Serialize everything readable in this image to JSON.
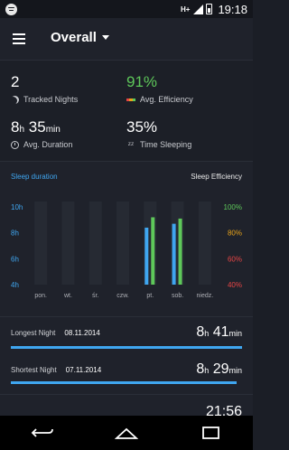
{
  "status_bar": {
    "network": "H+",
    "time": "19:18"
  },
  "app": {
    "title": "Overall",
    "accent": "#3fa6f0",
    "efficiency_green": "#5ec85a"
  },
  "summary": {
    "tracked_nights": {
      "value": "2",
      "label": "Tracked Nights"
    },
    "avg_efficiency": {
      "value": "91%",
      "label": "Avg. Efficiency"
    },
    "avg_duration": {
      "hours": "8",
      "h_unit": "h",
      "minutes": "35",
      "m_unit": "min",
      "label": "Avg. Duration"
    },
    "time_sleeping": {
      "value": "35%",
      "label": "Time Sleeping"
    }
  },
  "chart": {
    "left_title": "Sleep duration",
    "right_title": "Sleep Efficiency",
    "left_ticks": [
      "10h",
      "8h",
      "6h",
      "4h"
    ],
    "right_ticks": [
      "100%",
      "80%",
      "60%",
      "40%"
    ],
    "right_tick_colors": [
      "#5ec85a",
      "#e6a21a",
      "#e64545",
      "#e64545"
    ],
    "days": [
      "pon.",
      "wt.",
      "śr.",
      "czw.",
      "pt.",
      "sob.",
      "niedz."
    ]
  },
  "chart_data": {
    "type": "bar",
    "categories": [
      "pon.",
      "wt.",
      "śr.",
      "czw.",
      "pt.",
      "sob.",
      "niedz."
    ],
    "series": [
      {
        "name": "Sleep duration",
        "color": "#3fa6f0",
        "unit": "h",
        "values": [
          null,
          null,
          null,
          null,
          8.4,
          8.7,
          null
        ]
      },
      {
        "name": "Sleep Efficiency",
        "color": "#5ec85a",
        "unit": "%",
        "values": [
          null,
          null,
          null,
          null,
          92,
          91,
          null
        ]
      }
    ],
    "title": "",
    "left_axis": {
      "label": "Sleep duration",
      "ticks": [
        10,
        8,
        6,
        4
      ],
      "range": [
        4,
        10
      ]
    },
    "right_axis": {
      "label": "Sleep Efficiency",
      "ticks": [
        100,
        80,
        60,
        40
      ],
      "range": [
        40,
        100
      ]
    }
  },
  "longest": {
    "label": "Longest Night",
    "date": "08.11.2014",
    "hours": "8",
    "h_unit": "h",
    "minutes": "41",
    "m_unit": "min",
    "fraction": 1.0
  },
  "shortest": {
    "label": "Shortest Night",
    "date": "07.11.2014",
    "hours": "8",
    "h_unit": "h",
    "minutes": "29",
    "m_unit": "min",
    "fraction": 0.977
  },
  "partial_row": {
    "value": "21:56"
  },
  "icons": {
    "menu": "menu-icon",
    "caret": "chevron-down-icon",
    "moon": "moon-icon",
    "clock": "clock-icon",
    "zzz": "zzz-icon",
    "back": "back-icon",
    "home": "home-icon",
    "recents": "recents-icon"
  }
}
